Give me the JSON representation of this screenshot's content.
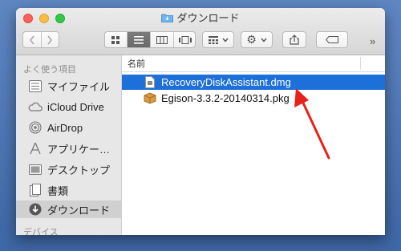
{
  "window": {
    "title": "ダウンロード"
  },
  "toolbar": {
    "more_label": "»"
  },
  "sidebar": {
    "section_favorites": "よく使う項目",
    "section_devices": "デバイス",
    "items": [
      {
        "label": "マイファイル",
        "icon": "all-my-files-icon"
      },
      {
        "label": "iCloud Drive",
        "icon": "cloud-icon"
      },
      {
        "label": "AirDrop",
        "icon": "airdrop-icon"
      },
      {
        "label": "アプリケー…",
        "icon": "applications-icon"
      },
      {
        "label": "デスクトップ",
        "icon": "desktop-icon"
      },
      {
        "label": "書類",
        "icon": "documents-icon"
      },
      {
        "label": "ダウンロード",
        "icon": "downloads-icon",
        "selected": true
      }
    ]
  },
  "list": {
    "column_name": "名前",
    "files": [
      {
        "name": "RecoveryDiskAssistant.dmg",
        "icon": "dmg-file-icon",
        "selected": true
      },
      {
        "name": "Egison-3.3.2-20140314.pkg",
        "icon": "package-icon",
        "selected": false
      }
    ]
  },
  "colors": {
    "selection": "#1d6fd9",
    "annotation_arrow": "#e8211b"
  }
}
